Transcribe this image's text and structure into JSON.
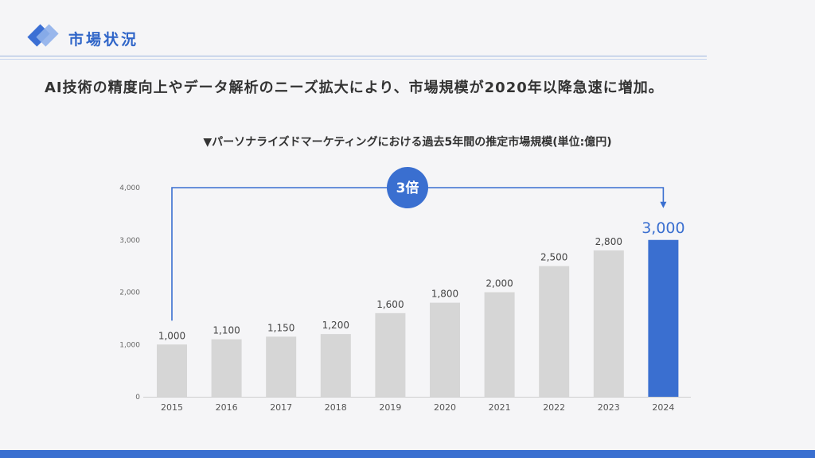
{
  "header": {
    "section_title": "市場状況",
    "logo_icon": "diamond-logo-icon"
  },
  "headline": "AI技術の精度向上やデータ解析のニーズ拡大により、市場規模が2020年以降急速に増加。",
  "colors": {
    "accent": "#3a6fd0",
    "bar": "#d6d6d6",
    "text": "#333333"
  },
  "chart_data": {
    "type": "bar",
    "title": "▼パーソナライズドマーケティングにおける過去5年間の推定市場規模(単位:億円)",
    "categories": [
      "2015",
      "2016",
      "2017",
      "2018",
      "2019",
      "2020",
      "2021",
      "2022",
      "2023",
      "2024"
    ],
    "values": [
      1000,
      1100,
      1150,
      1200,
      1600,
      1800,
      2000,
      2500,
      2800,
      3000
    ],
    "value_labels": [
      "1,000",
      "1,100",
      "1,150",
      "1,200",
      "1,600",
      "1,800",
      "2,000",
      "2,500",
      "2,800",
      "3,000"
    ],
    "yticks": [
      0,
      1000,
      2000,
      3000,
      4000
    ],
    "ytick_labels": [
      "0",
      "1,000",
      "2,000",
      "3,000",
      "4,000"
    ],
    "ylim": [
      0,
      4000
    ],
    "highlight_index": 9,
    "annotation": {
      "label": "3倍",
      "from": "2015",
      "to": "2024"
    },
    "xlabel": "",
    "ylabel": "",
    "grid": false,
    "legend": "none"
  }
}
